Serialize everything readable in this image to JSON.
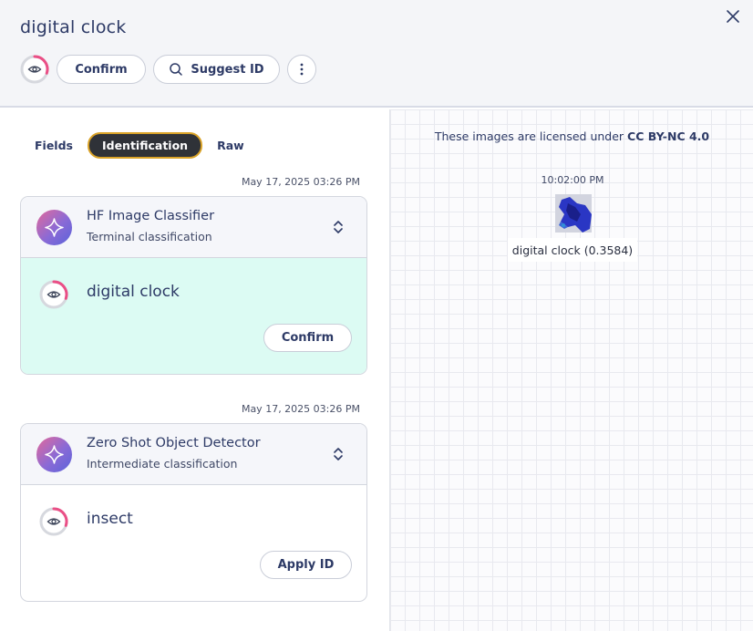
{
  "header": {
    "title": "digital clock",
    "confirm_label": "Confirm",
    "suggest_label": "Suggest ID"
  },
  "tabs": [
    {
      "label": "Fields",
      "active": false
    },
    {
      "label": "Identification",
      "active": true
    },
    {
      "label": "Raw",
      "active": false
    }
  ],
  "identifications": [
    {
      "timestamp": "May 17, 2025 03:26 PM",
      "algorithm": "HF Image Classifier",
      "classification": "Terminal classification",
      "taxon": "digital clock",
      "action_label": "Confirm",
      "highlighted": true
    },
    {
      "timestamp": "May 17, 2025 03:26 PM",
      "algorithm": "Zero Shot Object Detector",
      "classification": "Intermediate classification",
      "taxon": "insect",
      "action_label": "Apply ID",
      "highlighted": false
    }
  ],
  "viewer": {
    "license_prefix": "These images are licensed under",
    "license_name": "CC BY-NC 4.0",
    "capture_time": "10:02:00 PM",
    "detection_label": "digital clock (0.3584)"
  },
  "colors": {
    "accent_ring": "#ea4f86",
    "tab_active_bg": "#2f3238",
    "tab_active_border": "#d9a227",
    "highlight_bg": "#dcfbf3"
  },
  "icons": {
    "close": "close-icon",
    "eye": "eye-icon",
    "search": "search-icon",
    "more": "more-vertical-icon",
    "algorithm": "sparkle-icon",
    "expand": "chevron-up-down-icon"
  }
}
